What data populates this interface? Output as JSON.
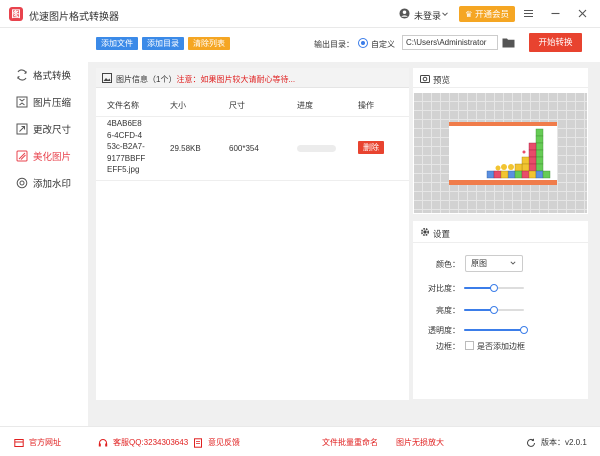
{
  "app": {
    "logo_text": "图",
    "title": "优速图片格式转换器",
    "user_label": "未登录",
    "vip_label": "开通会员"
  },
  "sidebar": {
    "items": [
      {
        "label": "格式转换",
        "icon": "format-icon",
        "active": false
      },
      {
        "label": "图片压缩",
        "icon": "compress-icon",
        "active": false
      },
      {
        "label": "更改尺寸",
        "icon": "resize-icon",
        "active": false
      },
      {
        "label": "美化图片",
        "icon": "beautify-icon",
        "active": true
      },
      {
        "label": "添加水印",
        "icon": "watermark-icon",
        "active": false
      }
    ]
  },
  "toolbar": {
    "add_file": "添加文件",
    "add_dir": "添加目录",
    "clear_list": "清除列表",
    "output_label": "输出目录：",
    "custom_label": "自定义",
    "output_path": "C:\\Users\\Administrator",
    "start": "开始转换",
    "colors": {
      "blue": "#3b8ae8",
      "orange": "#f5a623",
      "red": "#e8432f"
    }
  },
  "file_panel": {
    "title": "图片信息（1个）",
    "warning": "注意：如果图片较大请耐心等待...",
    "columns": [
      "文件名称",
      "大小",
      "尺寸",
      "进度",
      "操作"
    ],
    "rows": [
      {
        "name_lines": [
          "4BAB6E8",
          "6-4CFD-4",
          "53c-B2A7-",
          "9177BBFF",
          "EFF5.jpg"
        ],
        "size": "29.58KB",
        "dimensions": "600*354",
        "progress": 0,
        "action": "删除"
      }
    ]
  },
  "preview": {
    "title": "预览"
  },
  "settings": {
    "title": "设置",
    "color_label": "颜色：",
    "color_value": "原图",
    "contrast_label": "对比度：",
    "contrast_value": 0.5,
    "brightness_label": "亮度：",
    "brightness_value": 0.5,
    "transparency_label": "透明度：",
    "transparency_value": 1.0,
    "border_label": "边框：",
    "border_checkbox_label": "是否添加边框",
    "border_checked": false
  },
  "footer": {
    "website": "官方网址",
    "qq": "客服QQ:3234303643",
    "feedback": "意见反馈",
    "batch_rename": "文件批量重命名",
    "lossless": "图片无损放大",
    "version": "版本：v2.0.1"
  }
}
